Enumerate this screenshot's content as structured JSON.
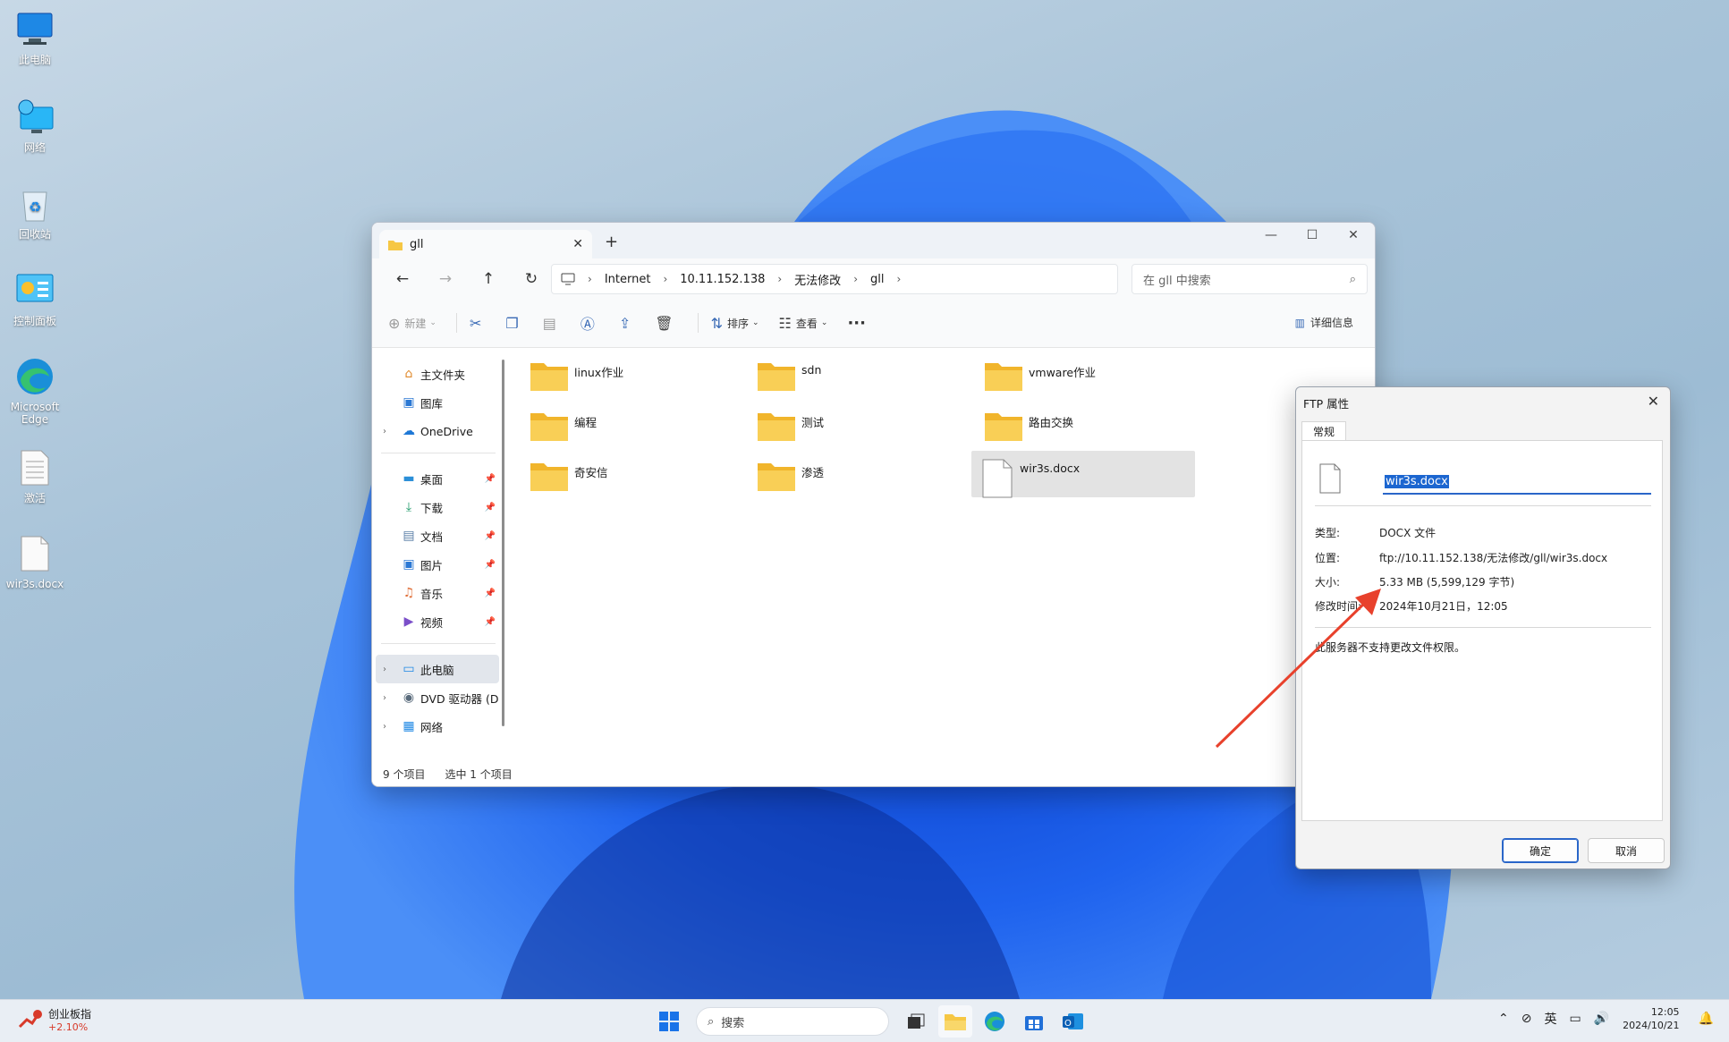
{
  "desktop": {
    "icons": [
      {
        "label": "此电脑",
        "icon": "computer-icon"
      },
      {
        "label": "网络",
        "icon": "network-icon"
      },
      {
        "label": "回收站",
        "icon": "recycle-bin-icon"
      },
      {
        "label": "控制面板",
        "icon": "control-panel-icon"
      },
      {
        "label": "Microsoft Edge",
        "icon": "edge-icon"
      },
      {
        "label": "激活",
        "icon": "text-file-icon"
      },
      {
        "label": "wir3s.docx",
        "icon": "document-icon"
      }
    ]
  },
  "explorer": {
    "tab_title": "gll",
    "new_tab": "+",
    "window_controls": {
      "minimize": "—",
      "maximize": "☐",
      "close": "✕"
    },
    "breadcrumb": [
      "Internet",
      "10.11.152.138",
      "无法修改",
      "gll"
    ],
    "search_placeholder": "在 gll 中搜索",
    "toolbar": {
      "new": "新建",
      "sort": "排序",
      "view": "查看",
      "more": "···",
      "details": "详细信息"
    },
    "sidebar": [
      {
        "label": "主文件夹",
        "icon": "home-icon"
      },
      {
        "label": "图库",
        "icon": "gallery-icon"
      },
      {
        "label": "OneDrive",
        "icon": "onedrive-icon"
      },
      {
        "label": "桌面",
        "icon": "desktop-icon"
      },
      {
        "label": "下载",
        "icon": "download-icon"
      },
      {
        "label": "文档",
        "icon": "documents-icon"
      },
      {
        "label": "图片",
        "icon": "pictures-icon"
      },
      {
        "label": "音乐",
        "icon": "music-icon"
      },
      {
        "label": "视频",
        "icon": "videos-icon"
      },
      {
        "label": "此电脑",
        "icon": "computer-icon"
      },
      {
        "label": "DVD 驱动器 (D",
        "icon": "dvd-icon"
      },
      {
        "label": "网络",
        "icon": "network-icon"
      }
    ],
    "files": [
      {
        "name": "linux作业",
        "type": "folder"
      },
      {
        "name": "sdn",
        "type": "folder"
      },
      {
        "name": "vmware作业",
        "type": "folder"
      },
      {
        "name": "编程",
        "type": "folder"
      },
      {
        "name": "测试",
        "type": "folder"
      },
      {
        "name": "路由交换",
        "type": "folder"
      },
      {
        "name": "奇安信",
        "type": "folder"
      },
      {
        "name": "渗透",
        "type": "folder"
      },
      {
        "name": "wir3s.docx",
        "type": "document"
      }
    ],
    "status": {
      "count": "9 个项目",
      "selected": "选中 1 个项目"
    }
  },
  "dialog": {
    "title": "FTP 属性",
    "tab": "常规",
    "filename": "wir3s.docx",
    "props": [
      {
        "key": "类型:",
        "value": "DOCX 文件"
      },
      {
        "key": "位置:",
        "value": "ftp://10.11.152.138/无法修改/gll/wir3s.docx"
      },
      {
        "key": "大小:",
        "value": "5.33 MB (5,599,129 字节)"
      },
      {
        "key": "修改时间:",
        "value": "2024年10月21日，12:05"
      }
    ],
    "note": "此服务器不支持更改文件权限。",
    "ok": "确定",
    "cancel": "取消"
  },
  "taskbar": {
    "stock_name": "创业板指",
    "stock_change": "+2.10%",
    "search": "搜索",
    "ime": "英",
    "time": "12:05",
    "date": "2024/10/21"
  },
  "colors": {
    "accent": "#1c66d0",
    "arrow": "#e8412c",
    "folder": "#f6c744"
  }
}
